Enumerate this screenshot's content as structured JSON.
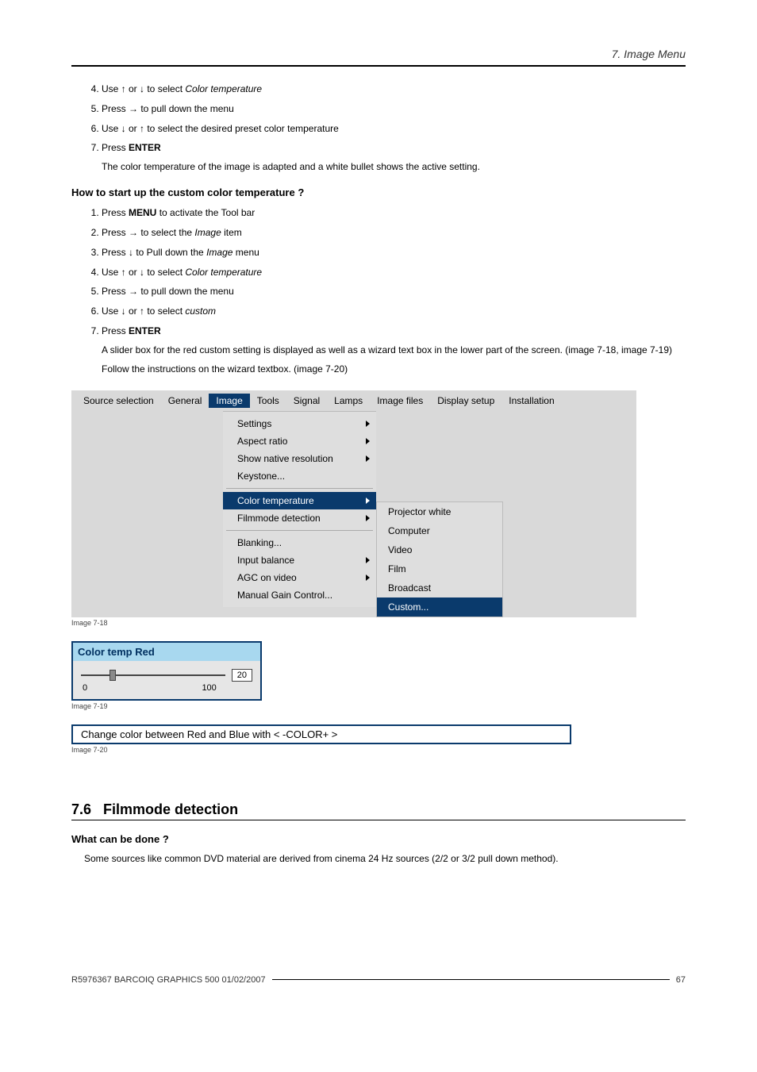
{
  "header": {
    "chapter": "7.  Image Menu"
  },
  "steps_a": [
    {
      "pre": "Use ↑ or ↓ to select ",
      "em": "Color temperature",
      "post": ""
    },
    {
      "pre": "Press → to pull down the menu",
      "em": "",
      "post": ""
    },
    {
      "pre": "Use ↓ or ↑ to select the desired preset color temperature",
      "em": "",
      "post": ""
    },
    {
      "pre": "Press ",
      "strong": "ENTER",
      "post": "",
      "sub": "The color temperature of the image is adapted and a white bullet shows the active setting."
    }
  ],
  "subhead1": "How to start up the custom color temperature ?",
  "steps_b": [
    {
      "pre": "Press ",
      "strong": "MENU",
      "post": " to activate the Tool bar"
    },
    {
      "pre": "Press → to select the ",
      "em": "Image",
      "post": " item"
    },
    {
      "pre": "Press ↓ to Pull down the ",
      "em": "Image",
      "post": " menu"
    },
    {
      "pre": "Use ↑ or ↓ to select ",
      "em": "Color temperature",
      "post": ""
    },
    {
      "pre": "Press → to pull down the menu",
      "em": "",
      "post": ""
    },
    {
      "pre": "Use ↓ or ↑ to select ",
      "em": "custom",
      "post": ""
    },
    {
      "pre": "Press ",
      "strong": "ENTER",
      "post": "",
      "sub": "A slider box for the red custom setting is displayed as well as a wizard text box in the lower part of the screen.  (image 7-18, image 7-19)",
      "sub2": "Follow the instructions on the wizard textbox.  (image 7-20)"
    }
  ],
  "fig718": {
    "caption": "Image 7-18",
    "menubar": [
      "Source selection",
      "General",
      "Image",
      "Tools",
      "Signal",
      "Lamps",
      "Image files",
      "Display setup",
      "Installation"
    ],
    "menubar_active": "Image",
    "dropdown_groups": [
      [
        {
          "label": "Settings",
          "arrow": true
        },
        {
          "label": "Aspect ratio",
          "arrow": true
        },
        {
          "label": "Show native resolution",
          "arrow": true
        },
        {
          "label": "Keystone...",
          "arrow": false
        }
      ],
      [
        {
          "label": "Color temperature",
          "arrow": true,
          "selected": true
        },
        {
          "label": "Filmmode detection",
          "arrow": true
        }
      ],
      [
        {
          "label": "Blanking...",
          "arrow": false
        },
        {
          "label": "Input balance",
          "arrow": true
        },
        {
          "label": "AGC on video",
          "arrow": true
        },
        {
          "label": "Manual Gain Control...",
          "arrow": false
        }
      ]
    ],
    "submenu": [
      {
        "label": "Projector white"
      },
      {
        "label": "Computer"
      },
      {
        "label": "Video"
      },
      {
        "label": "Film"
      },
      {
        "label": "Broadcast"
      },
      {
        "label": "Custom...",
        "selected": true
      }
    ]
  },
  "fig719": {
    "caption": "Image 7-19",
    "title": "Color temp Red",
    "min": "0",
    "max": "100",
    "value": "20"
  },
  "fig720": {
    "caption": "Image 7-20",
    "text": "Change color between Red and Blue with < -COLOR+ >"
  },
  "section": {
    "number": "7.6",
    "title": "Filmmode detection",
    "subhead": "What can be done ?",
    "body": "Some sources like common DVD material are derived from cinema 24 Hz sources (2/2 or 3/2 pull down method)."
  },
  "footer": {
    "left": "R5976367   BARCOIQ GRAPHICS 500   01/02/2007",
    "page": "67"
  },
  "chart_data": {
    "type": "bar",
    "title": "Color temp Red slider",
    "x": [
      0,
      100
    ],
    "value": 20,
    "note": "Single slider; value ≈20 on 0–100 range"
  }
}
